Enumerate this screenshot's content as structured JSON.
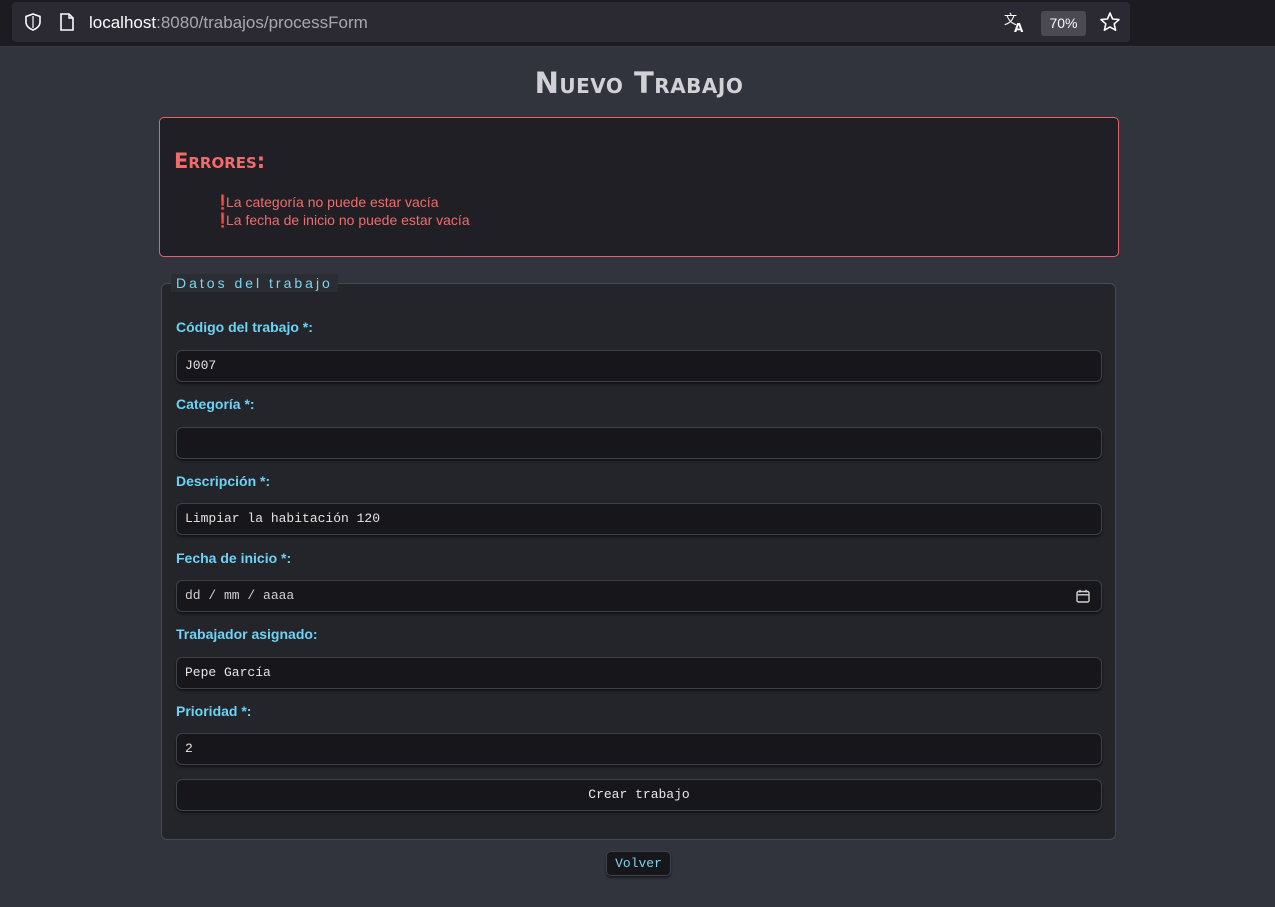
{
  "browser": {
    "url_host": "localhost",
    "url_path": ":8080/trabajos/processForm",
    "zoom": "70%"
  },
  "page": {
    "title": "Nuevo Trabajo"
  },
  "errors": {
    "heading": "Errores:",
    "marker": "❗",
    "items": [
      "La categoría no puede estar vacía",
      "La fecha de inicio no puede estar vacía"
    ]
  },
  "form": {
    "legend": "Datos del trabajo",
    "fields": {
      "codigo": {
        "label": "Código del trabajo *:",
        "value": "J007"
      },
      "categoria": {
        "label": "Categoría *:",
        "value": ""
      },
      "descripcion": {
        "label": "Descripción *:",
        "value": "Limpiar la habitación 120"
      },
      "fecha": {
        "label": "Fecha de inicio *:",
        "value": "dd / mm / aaaa"
      },
      "trabajador": {
        "label": "Trabajador asignado:",
        "value": "Pepe García"
      },
      "prioridad": {
        "label": "Prioridad *:",
        "value": "2"
      }
    },
    "submit_label": "Crear trabajo"
  },
  "back_label": "Volver",
  "icons": {
    "shield": "shield-icon",
    "page": "page-icon",
    "translate": "translate-icon",
    "star": "star-icon",
    "calendar": "calendar-icon"
  },
  "colors": {
    "background": "#31343d",
    "accent": "#6dd3f4",
    "error": "#f26b6b",
    "error_border": "#e8626a"
  }
}
